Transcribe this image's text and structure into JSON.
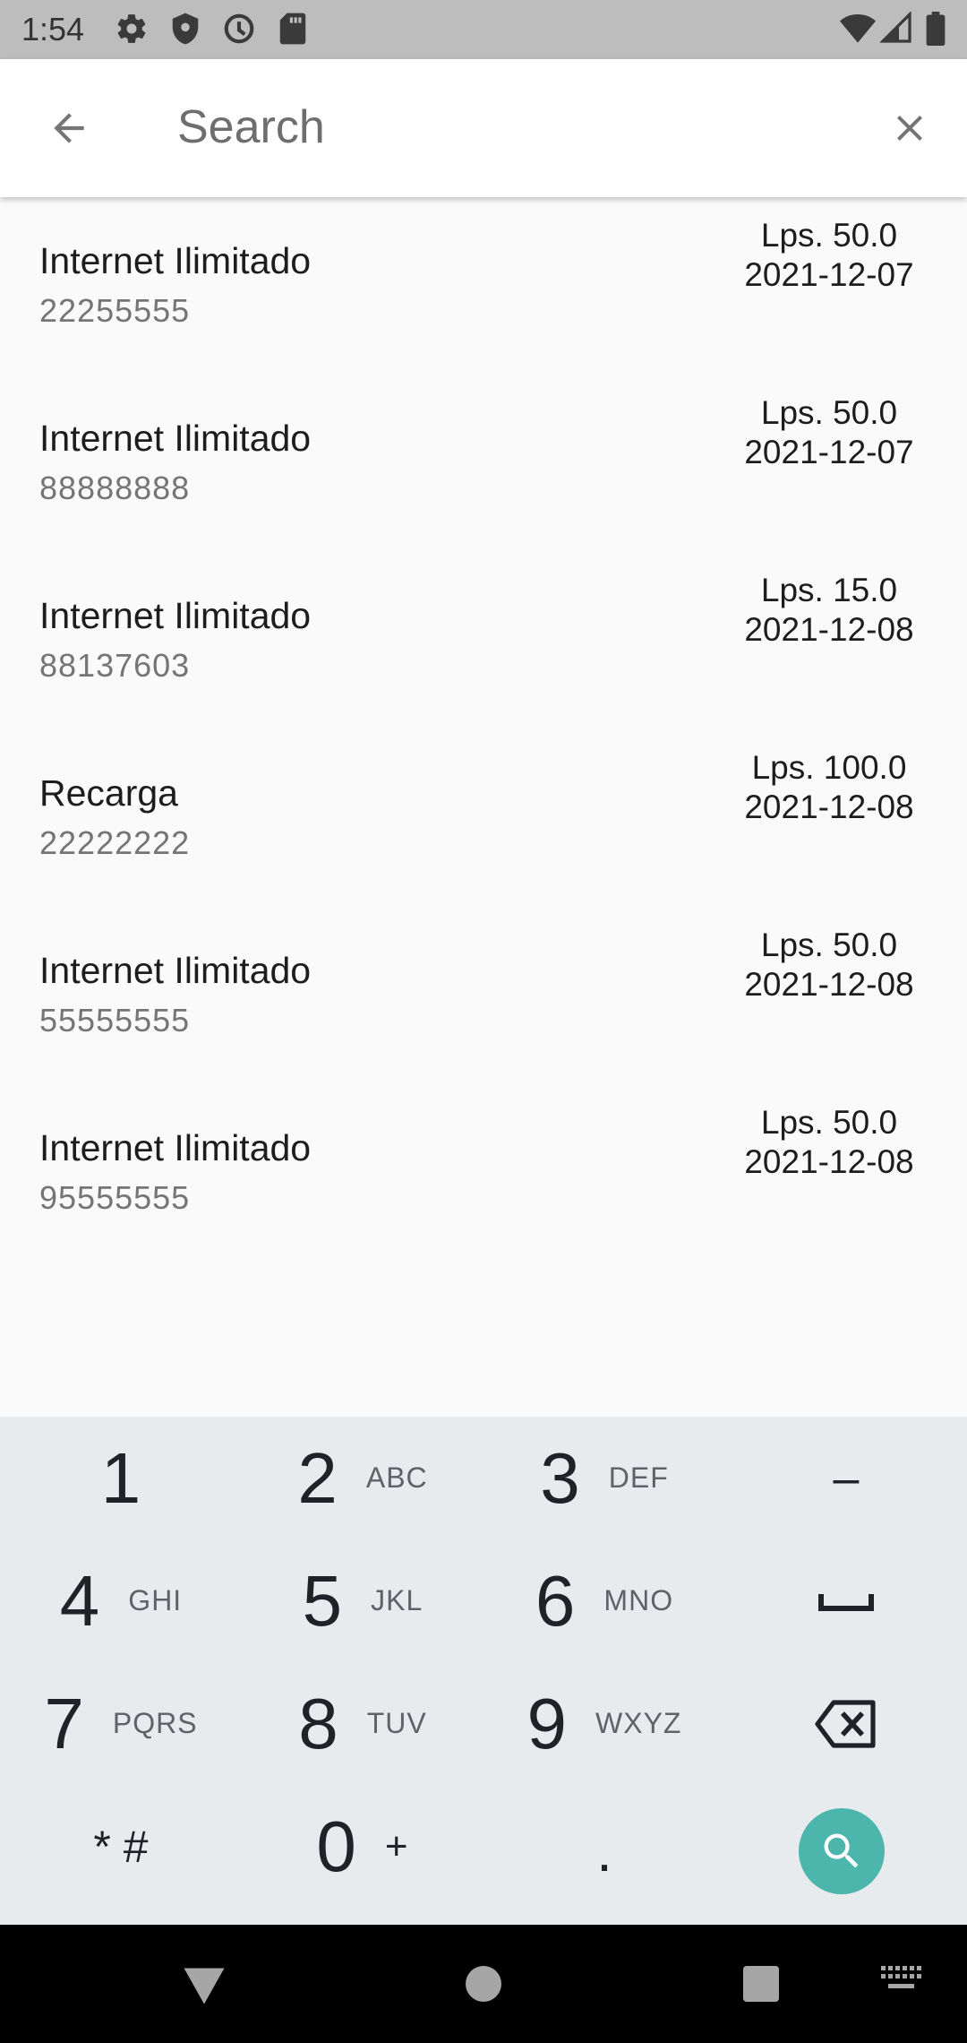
{
  "status_bar": {
    "time": "1:54",
    "left_icons": [
      "settings-icon",
      "shield-icon",
      "data-saver-icon",
      "sd-card-icon"
    ],
    "right_icons": [
      "wifi-icon",
      "signal-icon",
      "battery-icon"
    ]
  },
  "search": {
    "placeholder": "Search",
    "value": ""
  },
  "transactions": [
    {
      "title": "Internet Ilimitado",
      "number": "22255555",
      "amount": "Lps. 50.0",
      "date": "2021-12-07"
    },
    {
      "title": "Internet Ilimitado",
      "number": "88888888",
      "amount": "Lps. 50.0",
      "date": "2021-12-07"
    },
    {
      "title": "Internet Ilimitado",
      "number": "88137603",
      "amount": "Lps. 15.0",
      "date": "2021-12-08"
    },
    {
      "title": "Recarga",
      "number": "22222222",
      "amount": "Lps. 100.0",
      "date": "2021-12-08"
    },
    {
      "title": "Internet Ilimitado",
      "number": "55555555",
      "amount": "Lps. 50.0",
      "date": "2021-12-08"
    },
    {
      "title": "Internet Ilimitado",
      "number": "95555555",
      "amount": "Lps. 50.0",
      "date": "2021-12-08"
    }
  ],
  "keyboard": {
    "keys": [
      {
        "main": "1",
        "sub": ""
      },
      {
        "main": "2",
        "sub": "ABC"
      },
      {
        "main": "3",
        "sub": "DEF"
      },
      {
        "main": "–",
        "sub": ""
      },
      {
        "main": "4",
        "sub": "GHI"
      },
      {
        "main": "5",
        "sub": "JKL"
      },
      {
        "main": "6",
        "sub": "MNO"
      },
      {
        "main": "",
        "sub": "",
        "icon": "space-icon"
      },
      {
        "main": "7",
        "sub": "PQRS"
      },
      {
        "main": "8",
        "sub": "TUV"
      },
      {
        "main": "9",
        "sub": "WXYZ"
      },
      {
        "main": "",
        "sub": "",
        "icon": "backspace-icon"
      },
      {
        "main": "* #",
        "sub": ""
      },
      {
        "main": "0",
        "sub": "+"
      },
      {
        "main": ".",
        "sub": ""
      },
      {
        "main": "",
        "sub": "",
        "icon": "search-icon"
      }
    ],
    "search_key_color": "#4db6ac"
  },
  "nav_bar": {
    "icons": [
      "back-triangle-icon",
      "home-circle-icon",
      "recents-square-icon",
      "keyboard-icon"
    ]
  }
}
